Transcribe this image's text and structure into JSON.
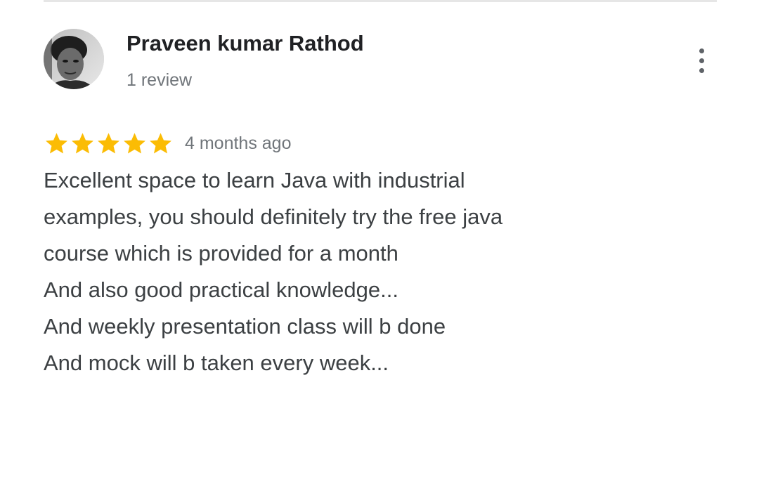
{
  "review": {
    "author_name": "Praveen kumar Rathod",
    "review_count": "1 review",
    "rating": 5,
    "rating_max": 5,
    "time_ago": "4 months ago",
    "text_lines": [
      "Excellent space to learn Java with industrial",
      "examples, you should definitely try the free java",
      "course which is provided for a month",
      "And also good practical knowledge...",
      "And weekly presentation class will b done",
      "And mock will b taken every week..."
    ]
  },
  "colors": {
    "star": "#fbbc04",
    "name": "#202124",
    "secondary_text": "#70757a",
    "body_text": "#3c4043",
    "menu_dots": "#5f6368"
  },
  "icons": {
    "more": "more-vert-icon",
    "star": "star-icon",
    "avatar": "profile-photo"
  }
}
